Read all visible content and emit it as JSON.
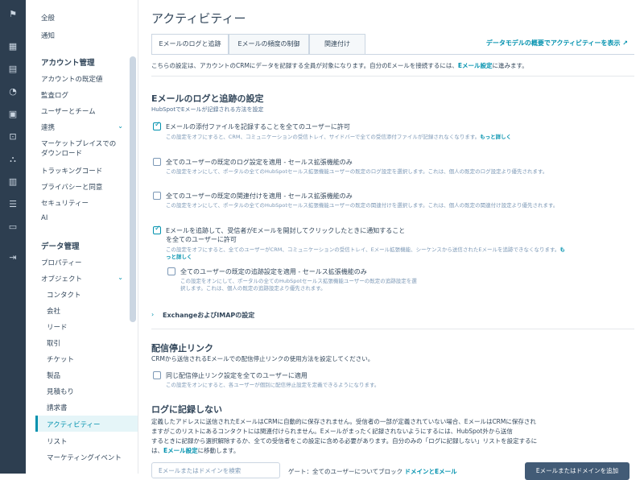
{
  "rail": {
    "icons": [
      "bookmark-icon",
      "grid-icon",
      "contacts-icon",
      "marketing-icon",
      "inbox-icon",
      "commerce-icon",
      "team-icon",
      "reports-icon",
      "data-icon",
      "folder-icon",
      "expand-icon"
    ]
  },
  "sidebar": {
    "items_top": [
      "全般",
      "通知"
    ],
    "account_heading": "アカウント管理",
    "account_items": [
      "アカウントの既定値",
      "監査ログ",
      "ユーザーとチーム",
      "連携",
      "マーケットプレイスでの",
      "ダウンロード",
      "トラッキングコード",
      "プライバシーと同意",
      "セキュリティー",
      "AI"
    ],
    "data_heading": "データ管理",
    "data_items": [
      "プロパティー",
      "オブジェクト"
    ],
    "object_items": [
      "コンタクト",
      "会社",
      "リード",
      "取引",
      "チケット",
      "製品",
      "見積もり",
      "請求書",
      "アクティビティー",
      "リスト",
      "マーケティングイベント"
    ]
  },
  "main": {
    "title": "アクティビティー",
    "tabs": [
      "Eメールのログと追跡",
      "Eメールの頻度の制御",
      "関連付け"
    ],
    "top_link": "データモデルの概要でアクティビティーを表示 ↗",
    "intro_text": "こちらの設定は、アカウントのCRMにデータを記録する全員が対象になります。自分のEメールを接続するには、",
    "intro_link": "Eメール設定",
    "intro_suffix": "に進みます。",
    "section1": {
      "title": "Eメールのログと追跡の設定",
      "subtitle": "HubSpotでEメールが記録される方法を設定",
      "options": [
        {
          "label": "Eメールの添付ファイルを記録することを全てのユーザーに許可",
          "desc": "この設定をオフにすると、CRM、コミュニケーションの受信トレイ、サイドバーで全ての受信添付ファイルが記録されなくなります。",
          "link": "もっと詳しく",
          "checked": true
        },
        {
          "label": "全てのユーザーの既定のログ設定を適用 - セールス拡張機能のみ",
          "desc": "この設定をオンにして、ポータルの全てのHubSpotセールス拡張機能ユーザーの既定のログ設定を選択します。これは、個人の既定のログ設定より優先されます。",
          "link": "",
          "checked": false
        },
        {
          "label": "全てのユーザーの既定の関連付けを適用 - セールス拡張機能のみ",
          "desc": "この設定をオンにして、ポータルの全てのHubSpotセールス拡張機能ユーザーの既定の関連付けを選択します。これは、個人の既定の関連付け設定より優先されます。",
          "link": "",
          "checked": false
        },
        {
          "label": "Eメールを追跡して、受信者がEメールを開封してクリックしたときに通知することを全てのユーザーに許可",
          "desc": "この設定をオフにすると、全てのユーザーがCRM、コミュニケーションの受信トレイ、Eメール拡張機能、シーケンスから送信されたEメールを追跡できなくなります。",
          "link": "もっと詳しく",
          "checked": true
        }
      ],
      "sub_option": {
        "label": "全てのユーザーの既定の追跡設定を適用 - セールス拡張機能のみ",
        "desc": "この設定をオンにして、ポータルの全てのHubSpotセールス拡張機能ユーザーの既定の追跡設定を選択します。これは、個人の既定の追跡設定より優先されます。",
        "checked": false
      },
      "exchange": "ExchangeおよびIMAPの設定"
    },
    "section2": {
      "title": "配信停止リンク",
      "subtitle": "CRMから送信されるEメールでの配信停止リンクの使用方法を設定してください。",
      "option": {
        "label": "同じ配信停止リンク設定を全てのユーザーに適用",
        "desc": "この設定をオンにすると、各ユーザーが個別に配信停止設定を定義できるようになります。",
        "checked": false
      }
    },
    "section3": {
      "title": "ログに記録しない",
      "desc_line1": "定義したアドレスに送信されたEメールはCRMに自動的に保存されません。受信者の一部が定義されていない場合、EメールはCRMに保存され",
      "desc_line2": "ますがこのリストにあるコンタクトには関連付けられません。Eメールがまったく記録されないようにするには、HubSpot外から送信",
      "desc_line3": "するときに記録から選択解除するか、全ての受信者をこの設定に含める必要があります。自分のみの「ログに記録しない」リストを設定するに",
      "desc_line4_pre": "は、",
      "desc_line4_link": "Eメール設定",
      "desc_line4_post": "に移動します。",
      "input_placeholder": "Eメールまたはドメインを検索",
      "bottom_text": "ゲート：全てのユーザーについてブロック",
      "bottom_link": "ドメインとEメール",
      "button": "Eメールまたはドメインを追加"
    }
  }
}
